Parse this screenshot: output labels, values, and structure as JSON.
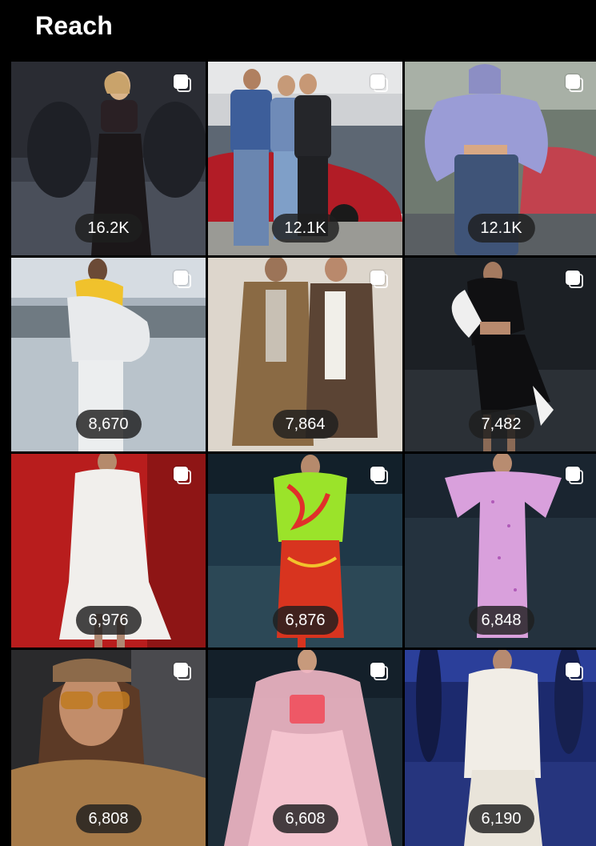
{
  "header": {
    "title": "Reach"
  },
  "posts": [
    {
      "reach": "16.2K"
    },
    {
      "reach": "12.1K"
    },
    {
      "reach": "12.1K"
    },
    {
      "reach": "8,670"
    },
    {
      "reach": "7,864"
    },
    {
      "reach": "7,482"
    },
    {
      "reach": "6,976"
    },
    {
      "reach": "6,876"
    },
    {
      "reach": "6,848"
    },
    {
      "reach": "6,808"
    },
    {
      "reach": "6,608"
    },
    {
      "reach": "6,190"
    }
  ],
  "icons": {
    "multi_post": "multiple-images-icon"
  }
}
